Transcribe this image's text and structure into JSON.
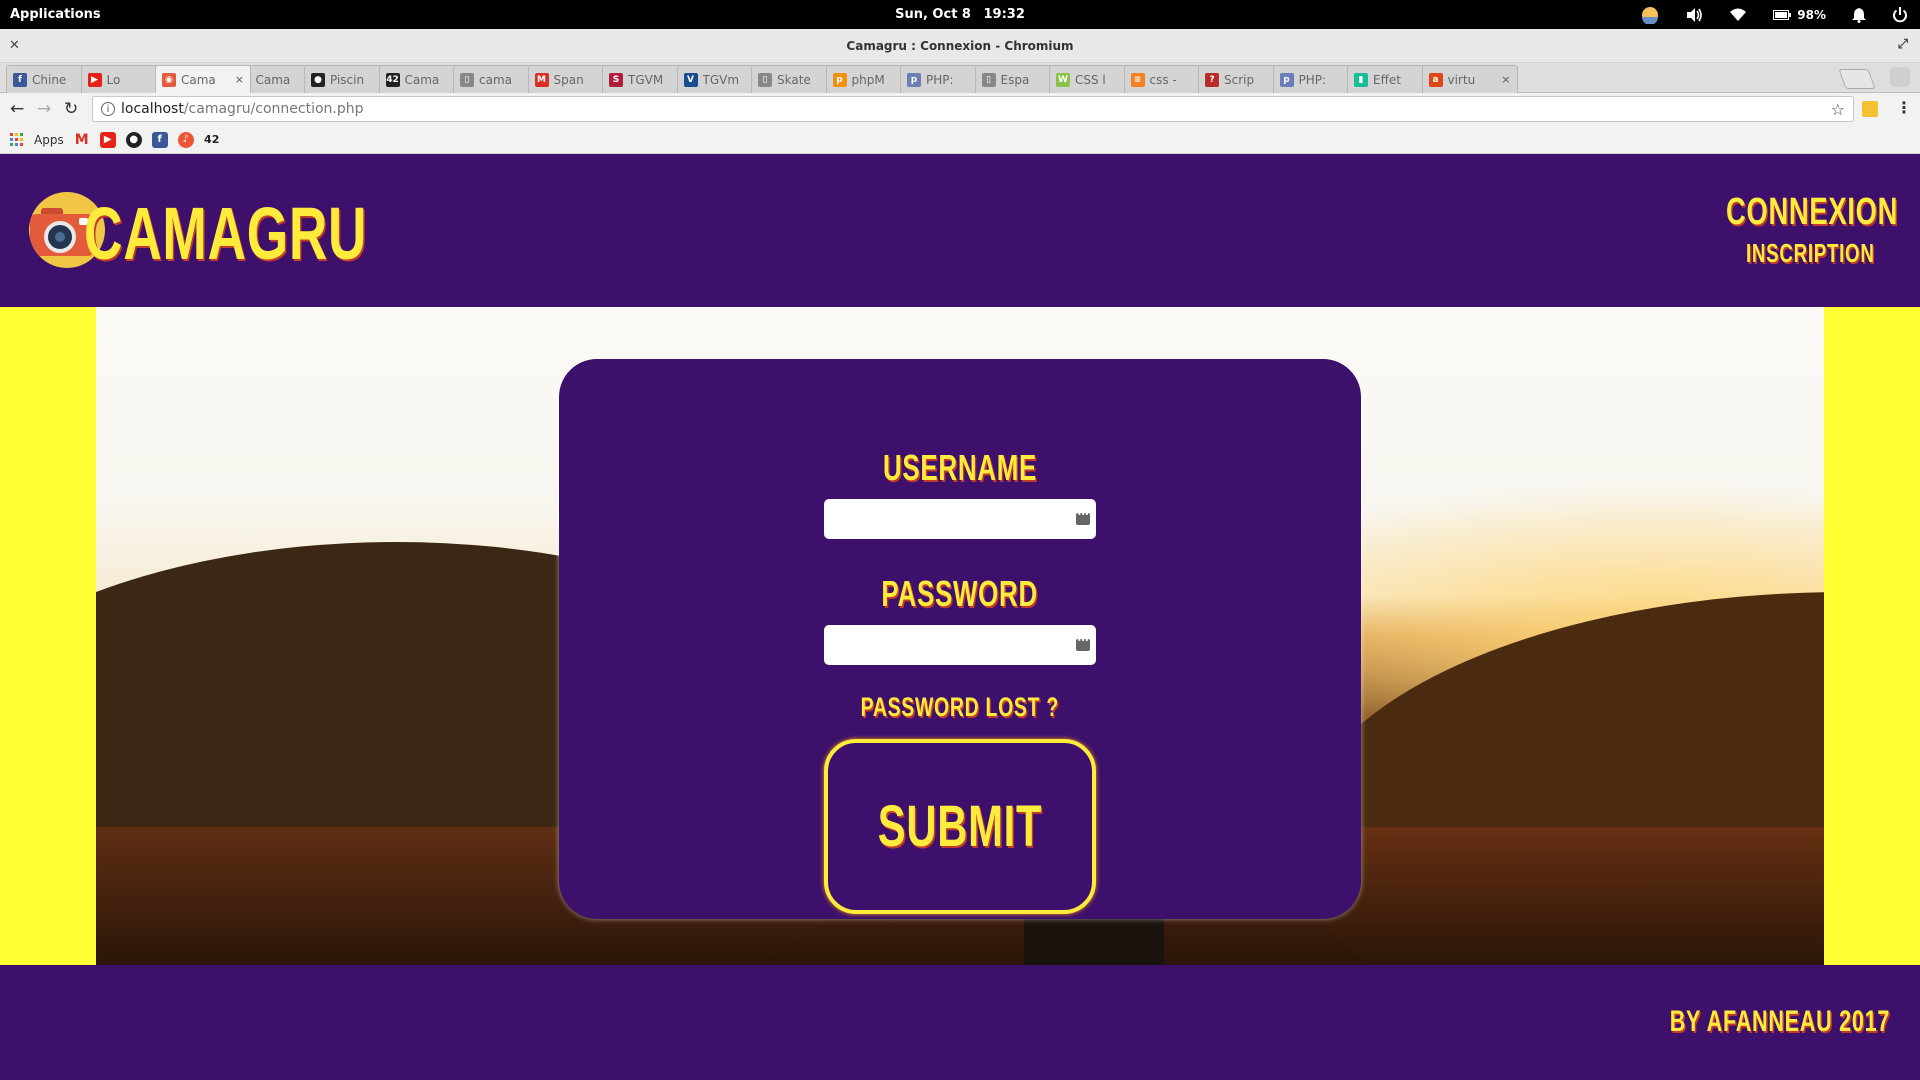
{
  "os": {
    "applications": "Applications",
    "date": "Sun, Oct 8",
    "time": "19:32",
    "battery": "98%"
  },
  "window": {
    "title": "Camagru : Connexion - Chromium"
  },
  "tabs": [
    {
      "label": "Chine",
      "icon": "facebook-icon",
      "color": "#3b5998"
    },
    {
      "label": "Lo",
      "icon": "youtube-icon",
      "color": "#e62117"
    },
    {
      "label": "Cama",
      "icon": "camagru-icon",
      "color": "#e45b3c"
    },
    {
      "label": "Cama",
      "icon": "github-icon",
      "color": "#222222"
    },
    {
      "label": "Piscin",
      "icon": "github-icon",
      "color": "#222222"
    },
    {
      "label": "Cama",
      "icon": "42-icon",
      "color": "#222222"
    },
    {
      "label": "cama",
      "icon": "page-icon",
      "color": "#888888"
    },
    {
      "label": "Span",
      "icon": "gmail-icon",
      "color": "#d93025"
    },
    {
      "label": "TGVM",
      "icon": "sncf-icon",
      "color": "#b01e3c"
    },
    {
      "label": "TGVm",
      "icon": "v-icon",
      "color": "#1a4d8f"
    },
    {
      "label": "Skate",
      "icon": "page-icon",
      "color": "#888888"
    },
    {
      "label": "phpM",
      "icon": "phpmyadmin-icon",
      "color": "#f29111"
    },
    {
      "label": "PHP:",
      "icon": "php-icon",
      "color": "#6c7eb7"
    },
    {
      "label": "Espa",
      "icon": "page-icon",
      "color": "#888888"
    },
    {
      "label": "CSS l",
      "icon": "w3c-icon",
      "color": "#8bc34a"
    },
    {
      "label": "css -",
      "icon": "stackoverflow-icon",
      "color": "#f48024"
    },
    {
      "label": "Scrip",
      "icon": "quora-icon",
      "color": "#b92b27"
    },
    {
      "label": "PHP:",
      "icon": "php-icon",
      "color": "#6c7eb7"
    },
    {
      "label": "Effet",
      "icon": "effet-icon",
      "color": "#1abc9c"
    },
    {
      "label": "virtu",
      "icon": "askubuntu-icon",
      "color": "#dd4814"
    }
  ],
  "omnibox": {
    "host": "localhost",
    "path": "/camagru/connection.php"
  },
  "bookmarks": {
    "apps_label": "Apps",
    "items": [
      "gmail-icon",
      "youtube-icon",
      "github-icon",
      "facebook-icon",
      "deezer-icon",
      "42-icon"
    ]
  },
  "site": {
    "title": "CAMAGRU",
    "nav": {
      "connexion": "CONNEXION",
      "inscription": "INSCRIPTION"
    },
    "colors": {
      "primary": "#3d116b",
      "accent": "#ffeb3b",
      "side": "#ffff33"
    }
  },
  "form": {
    "username_label": "USERNAME",
    "username_value": "",
    "password_label": "PASSWORD",
    "password_value": "",
    "lost_link": "PASSWORD LOST ?",
    "submit_label": "SUBMIT"
  },
  "footer": {
    "credit": "BY AFANNEAU 2017"
  }
}
